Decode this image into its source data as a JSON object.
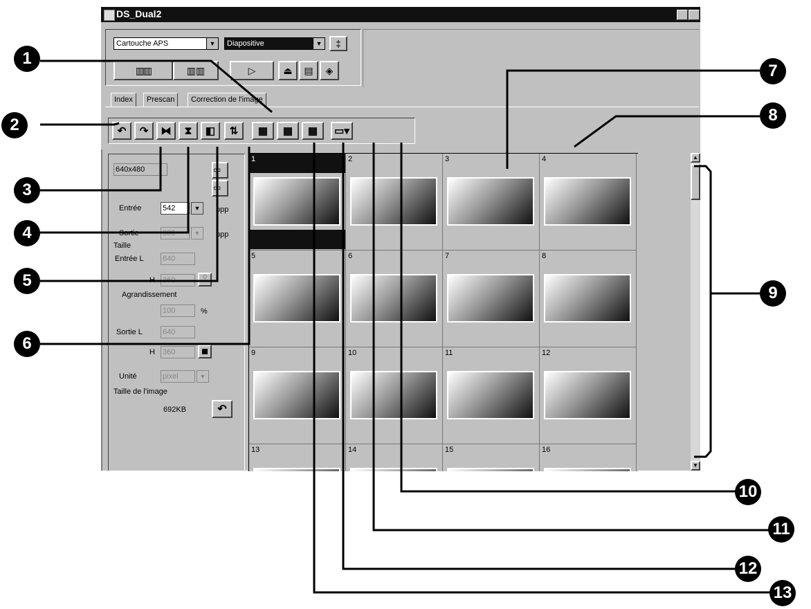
{
  "window": {
    "title": "DS_Dual2"
  },
  "toolbar": {
    "media_select": "Cartouche APS",
    "film_type_select": "Diapositive"
  },
  "tabs": [
    "Index",
    "Prescan",
    "Correction de l'image"
  ],
  "side_panel": {
    "resolution_value": "640x480",
    "input_label": "Entrée",
    "input_value": "542",
    "output_label": "Sortie",
    "output_value": "300",
    "dpi_unit": "ppp",
    "size_heading": "Taille",
    "input_width_label": "Entrée L",
    "input_width_value": "640",
    "input_height_label": "H",
    "input_height_value": "360",
    "enlargement_label": "Agrandissement",
    "enlargement_value": "100",
    "percent_sign": "%",
    "output_width_label": "Sortie L",
    "output_width_value": "640",
    "output_height_label": "H",
    "output_height_value": "360",
    "unit_label": "Unité",
    "unit_value": "pixel",
    "image_size_label": "Taille de l'image",
    "image_size_value": "692KB"
  },
  "frames": [
    "1",
    "2",
    "3",
    "4",
    "5",
    "6",
    "7",
    "8",
    "9",
    "10",
    "11",
    "12",
    "13",
    "14",
    "15",
    "16"
  ],
  "callouts": [
    "1",
    "2",
    "3",
    "4",
    "5",
    "6",
    "7",
    "8",
    "9",
    "10",
    "11",
    "12",
    "13"
  ],
  "icons": [
    "rotate-left-icon",
    "rotate-right-icon",
    "flip-horizontal-icon",
    "flip-vertical-icon",
    "negative-icon",
    "swap-icon",
    "index-scan-icon",
    "selected-scan-icon",
    "save-icon",
    "menu-icon"
  ]
}
